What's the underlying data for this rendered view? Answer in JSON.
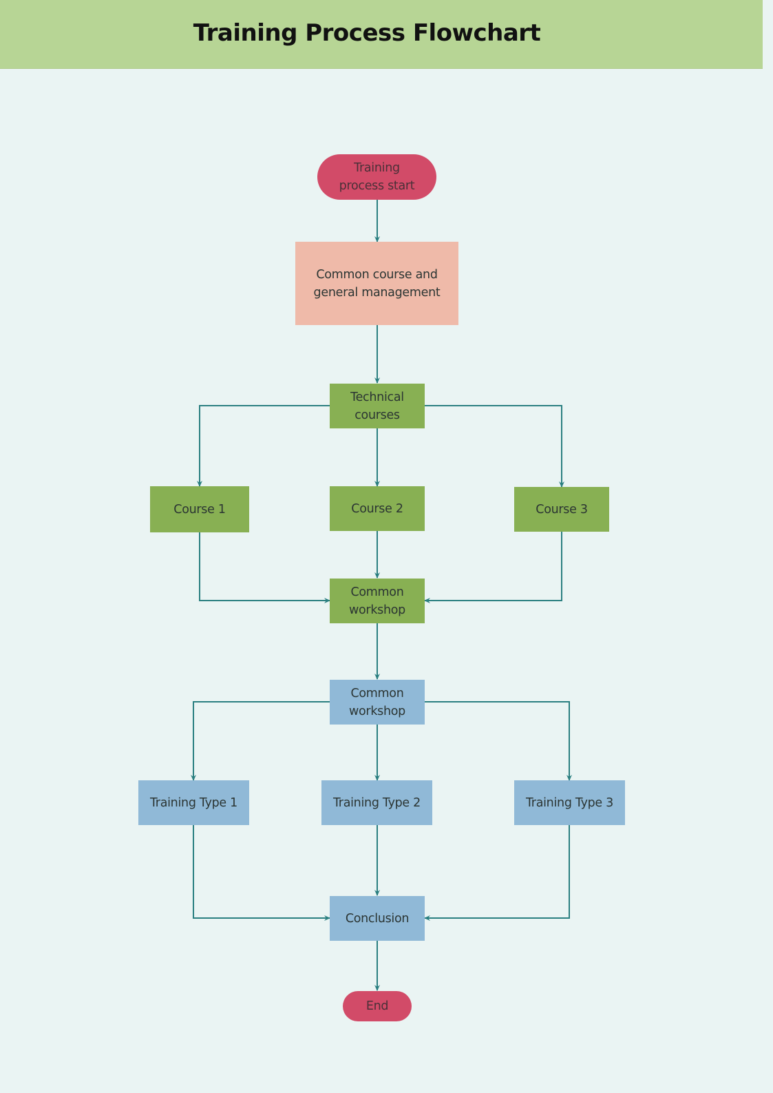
{
  "header": {
    "title": "Training Process Flowchart"
  },
  "colors": {
    "header_bg": "#b7d595",
    "page_bg": "#eaf4f3",
    "terminal": "#d24b68",
    "salmon": "#efbaa9",
    "green": "#88b053",
    "blue": "#90b9d7",
    "connector": "#2a7f80"
  },
  "nodes": {
    "start": "Training\nprocess start",
    "common_course": "Common course and\ngeneral management",
    "technical_courses": "Technical\ncourses",
    "course1": "Course 1",
    "course2": "Course 2",
    "course3": "Course 3",
    "common_workshop_green": "Common\nworkshop",
    "common_workshop_blue": "Common\nworkshop",
    "training_type1": "Training Type 1",
    "training_type2": "Training Type 2",
    "training_type3": "Training Type 3",
    "conclusion": "Conclusion",
    "end": "End"
  },
  "edges": [
    [
      "start",
      "common_course"
    ],
    [
      "common_course",
      "technical_courses"
    ],
    [
      "technical_courses",
      "course1"
    ],
    [
      "technical_courses",
      "course2"
    ],
    [
      "technical_courses",
      "course3"
    ],
    [
      "course1",
      "common_workshop_green"
    ],
    [
      "course2",
      "common_workshop_green"
    ],
    [
      "course3",
      "common_workshop_green"
    ],
    [
      "common_workshop_green",
      "common_workshop_blue"
    ],
    [
      "common_workshop_blue",
      "training_type1"
    ],
    [
      "common_workshop_blue",
      "training_type2"
    ],
    [
      "common_workshop_blue",
      "training_type3"
    ],
    [
      "training_type1",
      "conclusion"
    ],
    [
      "training_type2",
      "conclusion"
    ],
    [
      "training_type3",
      "conclusion"
    ],
    [
      "conclusion",
      "end"
    ]
  ]
}
